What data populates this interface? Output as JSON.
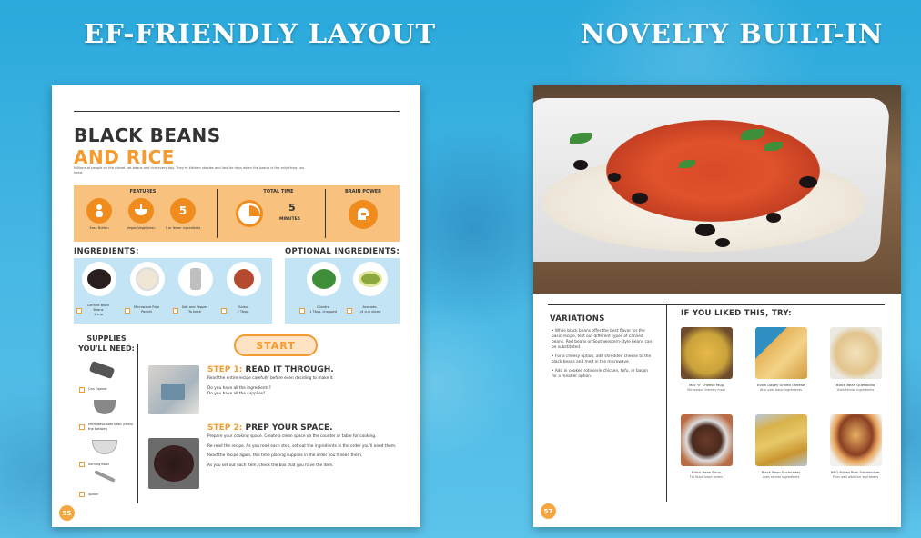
{
  "headings": {
    "left": "EF-FRIENDLY LAYOUT",
    "right": "NOVELTY BUILT-IN"
  },
  "left_page": {
    "title_line1": "BLACK BEANS",
    "title_line2": "AND RICE",
    "intro": "Millions of people on the planet eat beans and rice every day. They're kitchen staples and last for days when the basics is the only thing you need.",
    "band": {
      "features_label": "FEATURES",
      "features": [
        {
          "icon": "person-icon",
          "text": "Easy Button"
        },
        {
          "icon": "bowl-icon",
          "text": "Vegan/Vegetarian"
        },
        {
          "icon": "five-icon",
          "glyph": "5",
          "text": "5 or fewer ingredients"
        }
      ],
      "total_time_label": "TOTAL TIME",
      "total_time_value": "5",
      "total_time_unit": "MINUTES",
      "brain_power_label": "BRAIN POWER"
    },
    "ingredients_label": "INGREDIENTS:",
    "ingredients": [
      {
        "name": "Canned Black Beans",
        "amount": "1 cup",
        "color": "#2b1e1e"
      },
      {
        "name": "Microwave Rice Packet",
        "amount": "",
        "color": "#efe6d6"
      },
      {
        "name": "Salt and Pepper",
        "amount": "To taste",
        "color": "#bfbfbf"
      },
      {
        "name": "Salsa",
        "amount": "2 Tbsp.",
        "color": "#b54a2e"
      }
    ],
    "optional_label": "OPTIONAL INGREDIENTS:",
    "optional": [
      {
        "name": "Cilantro",
        "amount": "1 Tbsp. chopped",
        "color": "#3f8f3a"
      },
      {
        "name": "Avocado",
        "amount": "1/4 cup sliced",
        "color": "#8aa83e"
      }
    ],
    "supplies_label": "SUPPLIES YOU'LL NEED:",
    "supplies": [
      {
        "name": "Can Opener"
      },
      {
        "name": "Microwave-safe bowl (check the bottom)"
      },
      {
        "name": "Serving Bowl"
      },
      {
        "name": "Spoon"
      }
    ],
    "start_label": "START",
    "step1": {
      "num": "STEP 1:",
      "title": "READ IT THROUGH.",
      "lines": [
        "Read the entire recipe carefully before even deciding to make it.",
        "Do you have all the ingredients?",
        "Do you have all the supplies?"
      ]
    },
    "step2": {
      "num": "STEP 2:",
      "title": "PREP YOUR SPACE.",
      "lines": [
        "Prepare your cooking space. Create a clean space on the counter or table for cooking.",
        "Re-read the recipe. As you read each step, set out the ingredients in the order you'll need them.",
        "Read the recipe again, this time placing supplies in the order you'll need them.",
        "As you set out each item, check the box that you have the item."
      ]
    },
    "page_number": "55"
  },
  "right_page": {
    "variations_label": "VARIATIONS",
    "variations": [
      "• While black beans offer the best flavor for the basic recipe, test out different types of canned beans. Red beans or Southwestern-style beans can be substituted.",
      "• For a cheesy option, add shredded cheese to the black beans and melt in the microwave.",
      "• Add in cooked rotisserie chicken, tofu, or bacon for a meatier option."
    ],
    "liked_label": "IF YOU LIKED THIS, TRY:",
    "suggestions": [
      {
        "title": "Mac 'n' Cheese Mug",
        "sub": "Microwave-friendly meal",
        "color": "#c9a23a"
      },
      {
        "title": "Extra Gooey Grilled Cheese",
        "sub": "Also uses basic ingredients",
        "color": "#e6b45a"
      },
      {
        "title": "Black Bean Quesadilla",
        "sub": "Uses similar ingredients",
        "color": "#e2c48d"
      },
      {
        "title": "Black Bean Soup",
        "sub": "For black bean lovers",
        "color": "#6b3a2a"
      },
      {
        "title": "Black Bean Enchiladas",
        "sub": "Uses similar ingredients",
        "color": "#d9b24b"
      },
      {
        "title": "BBQ Pulled Pork Sandwiches",
        "sub": "Pairs well with rice and beans",
        "color": "#8a3f24"
      }
    ],
    "page_number": "57"
  }
}
